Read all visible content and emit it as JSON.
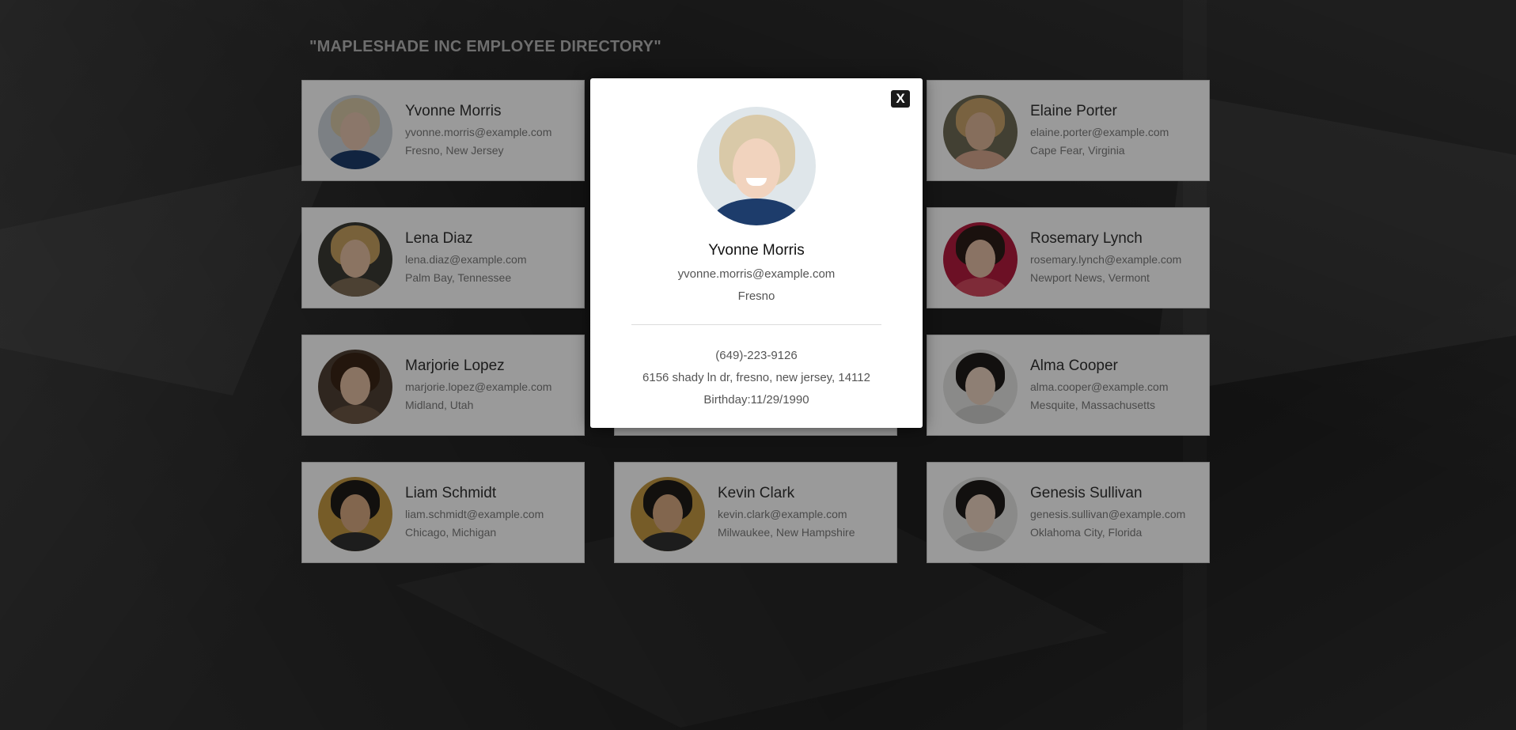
{
  "page": {
    "title": "\"MAPLESHADE INC EMPLOYEE DIRECTORY\""
  },
  "employees": [
    {
      "name": "Yvonne Morris",
      "email": "yvonne.morris@example.com",
      "location": "Fresno, New Jersey",
      "avatar_colors": [
        "#cfd6dc",
        "#e8c7b0",
        "#d8c9a8",
        "#1d3c6b"
      ]
    },
    {
      "name": "Elaine Porter",
      "email": "elaine.porter@example.com",
      "location": "Cape Fear, Virginia",
      "avatar_colors": [
        "#6e6a55",
        "#e0b79a",
        "#c9a46a",
        "#d8a890"
      ]
    },
    {
      "name": "Lena Diaz",
      "email": "lena.diaz@example.com",
      "location": "Palm Bay, Tennessee",
      "avatar_colors": [
        "#3b3b34",
        "#e7c2a4",
        "#c8a260",
        "#7e6c55"
      ]
    },
    {
      "name": "Rosemary Lynch",
      "email": "rosemary.lynch@example.com",
      "location": "Newport News, Vermont",
      "avatar_colors": [
        "#b41b3e",
        "#e6c0a6",
        "#2b1d17",
        "#d2485e"
      ]
    },
    {
      "name": "Marjorie Lopez",
      "email": "marjorie.lopez@example.com",
      "location": "Midland, Utah",
      "avatar_colors": [
        "#4f4033",
        "#e5bfa4",
        "#3a2516",
        "#6d5744"
      ]
    },
    {
      "name": "Alma Cooper",
      "email": "alma.cooper@example.com",
      "location": "Mesquite, Massachusetts",
      "avatar_colors": [
        "#e6e6e4",
        "#ecd4c2",
        "#1e1b19",
        "#cfcfcd"
      ]
    },
    {
      "name": "Liam Schmidt",
      "email": "liam.schmidt@example.com",
      "location": "Chicago, Michigan",
      "avatar_colors": [
        "#c49a42",
        "#d9aa82",
        "#1e1b18",
        "#313131"
      ]
    },
    {
      "name": "Kevin Clark",
      "email": "kevin.clark@example.com",
      "location": "Milwaukee, New Hampshire",
      "avatar_colors": [
        "#c49a42",
        "#d9aa82",
        "#1e1b18",
        "#313131"
      ]
    },
    {
      "name": "Genesis Sullivan",
      "email": "genesis.sullivan@example.com",
      "location": "Oklahoma City, Florida",
      "avatar_colors": [
        "#e6e6e4",
        "#ecd4c2",
        "#1e1b19",
        "#cfcfcd"
      ]
    }
  ],
  "modal": {
    "close_label": "X",
    "name": "Yvonne Morris",
    "email": "yvonne.morris@example.com",
    "city": "Fresno",
    "phone": "(649)-223-9126",
    "address": "6156 shady ln dr, fresno, new jersey, 14112",
    "birthday": "Birthday:11/29/1990"
  }
}
